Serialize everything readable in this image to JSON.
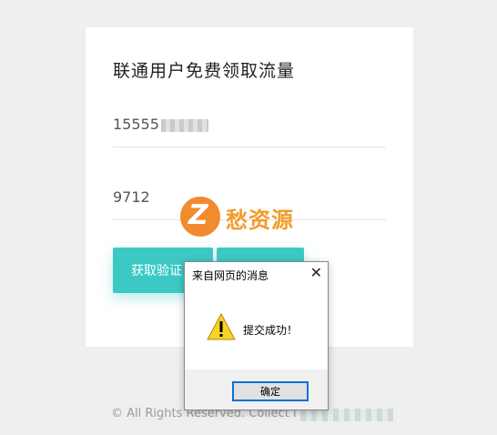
{
  "form": {
    "title": "联通用户免费领取流量",
    "phone_value": "15555",
    "code_value": "9712",
    "get_code_label": "获取验证",
    "submit_label": ""
  },
  "watermark": {
    "letter": "Z",
    "text": "愁资源"
  },
  "footer": {
    "text": "© All Rights Reserved. Collect I"
  },
  "dialog": {
    "title": "来自网页的消息",
    "close_glyph": "✕",
    "message": "提交成功！",
    "ok_label": "确定"
  },
  "colors": {
    "accent": "#3cc9c6",
    "watermark": "#f29b2a",
    "dialog_button_border": "#0f6ed6"
  }
}
